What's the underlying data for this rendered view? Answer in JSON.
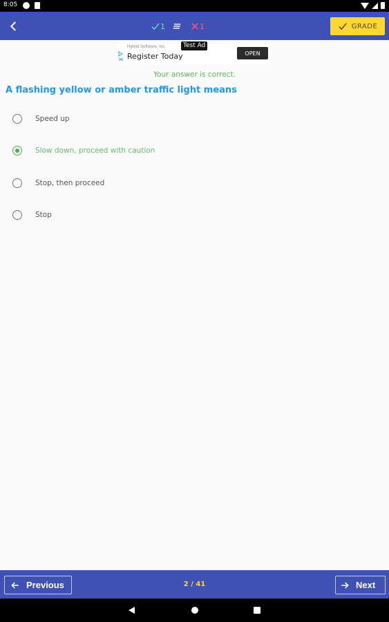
{
  "status_bar": {
    "time": "8:05"
  },
  "app_bar": {
    "correct_count": "1",
    "wrong_count": "1",
    "grade_label": "GRADE",
    "colors": {
      "background": "#3f51b5",
      "grade_button": "#fdd835"
    }
  },
  "ad": {
    "advertiser": "Hybrid Software, Inc.",
    "title": "Register Today",
    "open_label": "OPEN",
    "test_badge": "Test Ad"
  },
  "feedback": "Your answer is correct.",
  "question": "A flashing yellow or amber traffic light means",
  "options": [
    {
      "label": "Speed up",
      "selected": false
    },
    {
      "label": "Slow down, proceed with caution",
      "selected": true
    },
    {
      "label": "Stop, then proceed",
      "selected": false
    },
    {
      "label": "Stop",
      "selected": false
    }
  ],
  "bottom_bar": {
    "previous_label": "Previous",
    "next_label": "Next",
    "page_indicator": "2 / 41"
  }
}
